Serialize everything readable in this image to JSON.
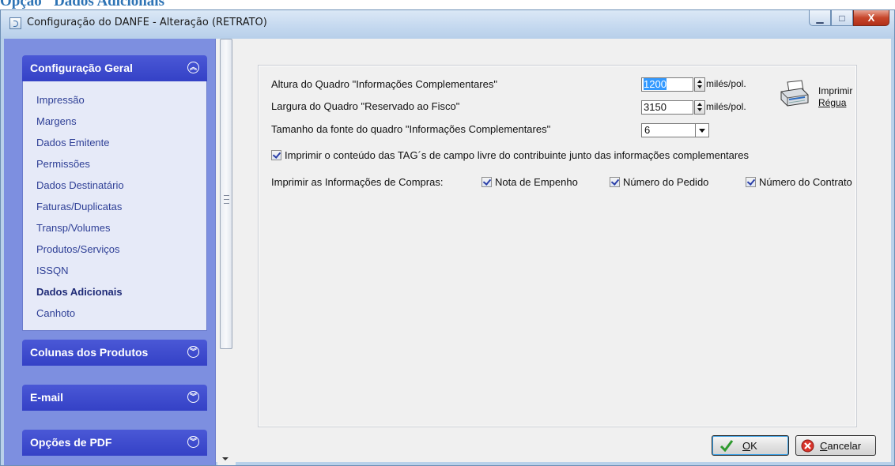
{
  "doc_heading": "Opção \"Dados Adicionais\"",
  "window": {
    "title": "Configuração do DANFE - Alteração  (RETRATO)",
    "controls": {
      "minimize": "▁",
      "maximize": "□",
      "close": "X"
    }
  },
  "sidebar": {
    "groups": [
      {
        "label": "Configuração Geral",
        "expanded": true,
        "chevron": "︽"
      },
      {
        "label": "Colunas dos Produtos",
        "expanded": false,
        "chevron": "︾"
      },
      {
        "label": "E-mail",
        "expanded": false,
        "chevron": "︾"
      },
      {
        "label": "Opções de PDF",
        "expanded": false,
        "chevron": "︾"
      }
    ],
    "items": [
      {
        "label": "Impressão"
      },
      {
        "label": "Margens"
      },
      {
        "label": "Dados Emitente"
      },
      {
        "label": "Permissões"
      },
      {
        "label": "Dados Destinatário"
      },
      {
        "label": "Faturas/Duplicatas"
      },
      {
        "label": "Transp/Volumes"
      },
      {
        "label": "Produtos/Serviços"
      },
      {
        "label": "ISSQN"
      },
      {
        "label": "Dados Adicionais",
        "active": true
      },
      {
        "label": "Canhoto"
      }
    ]
  },
  "form": {
    "altura": {
      "label": "Altura do Quadro \"Informações Complementares\"",
      "value": "1200",
      "unit": "milés/pol."
    },
    "largura": {
      "label": "Largura do Quadro \"Reservado ao Fisco\"",
      "value": "3150",
      "unit": "milés/pol."
    },
    "fonte": {
      "label": "Tamanho da fonte do quadro \"Informações Complementares\"",
      "value": "6"
    },
    "tag_checkbox": {
      "label": "Imprimir o conteúdo das TAG´s de campo livre do contribuinte junto das informações complementares",
      "checked": true
    },
    "compras": {
      "label": "Imprimir as Informações de Compras:",
      "options": [
        {
          "label": "Nota de Empenho",
          "checked": true
        },
        {
          "label": "Número do Pedido",
          "checked": true
        },
        {
          "label": "Número do Contrato",
          "checked": true
        }
      ]
    },
    "print_ruler": {
      "line1": "Imprimir",
      "line2": "Régua",
      "icon": "printer-icon"
    }
  },
  "buttons": {
    "ok": {
      "mnemonic": "O",
      "rest": "K"
    },
    "cancel": {
      "mnemonic": "C",
      "rest": "ancelar"
    }
  },
  "colors": {
    "accent": "#3441c6",
    "sidebar_bg": "#7d8fe0",
    "window_frame": "#b9d1ea"
  }
}
